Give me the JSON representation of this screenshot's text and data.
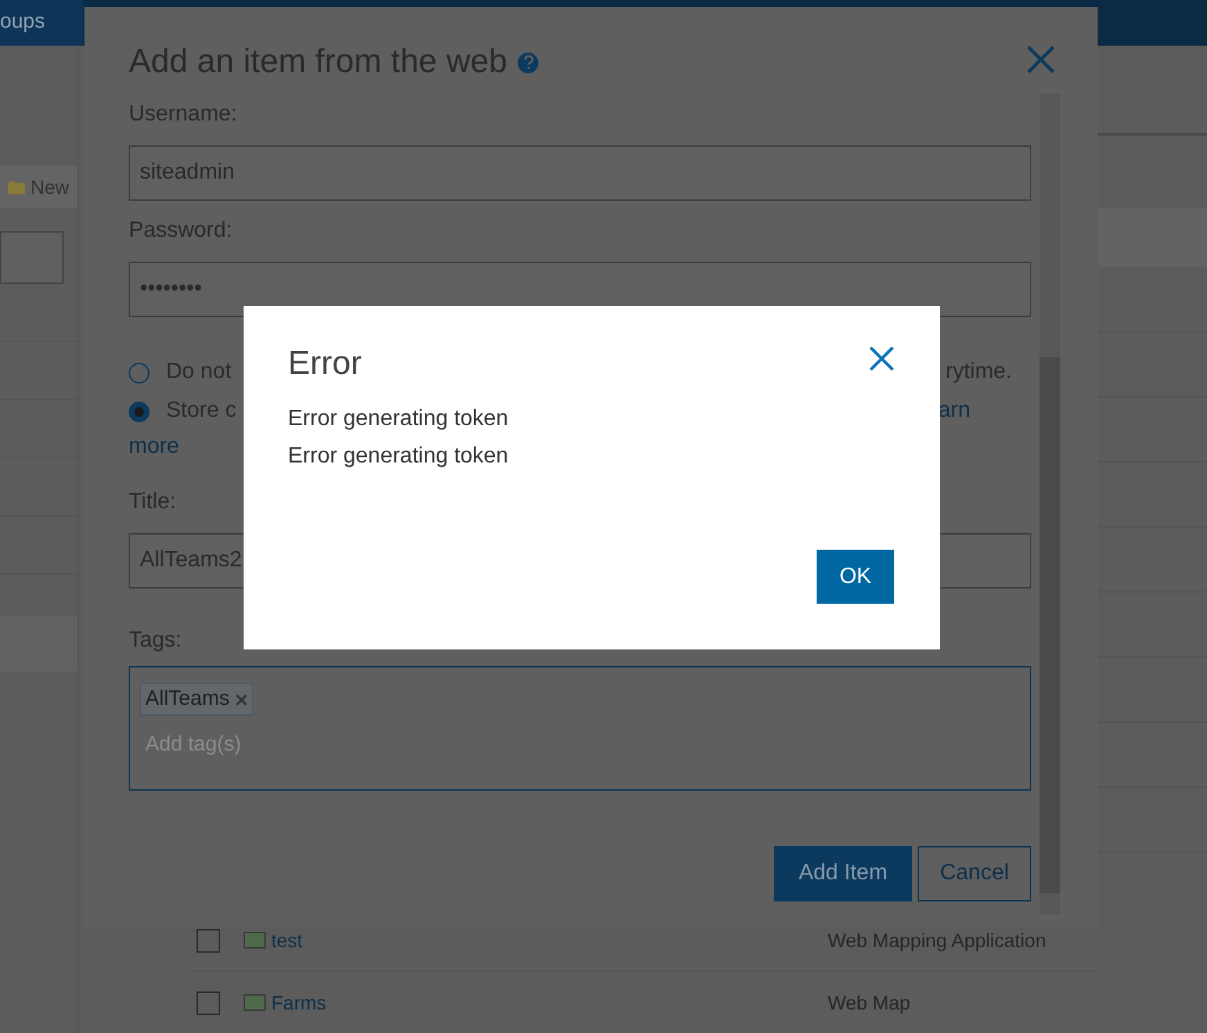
{
  "nav": {
    "tab": "oups"
  },
  "sidebar": {
    "new_button": "New"
  },
  "list": {
    "rows": [
      {
        "name": "test",
        "type": "Web Mapping Application",
        "checked": false
      },
      {
        "name": "Farms",
        "type": "Web Map",
        "checked": false
      }
    ]
  },
  "dialog": {
    "title": "Add an item from the web",
    "fields": [
      {
        "label": "Username:",
        "value": "siteadmin"
      },
      {
        "label": "Password:",
        "value": "••••••••"
      }
    ],
    "credentials": [
      {
        "text": "Do not",
        "tail": "rytime.",
        "selected": false
      },
      {
        "text": "Store c",
        "tail": "arn",
        "selected": true
      }
    ],
    "learn_more": "more",
    "title_field": {
      "label": "Title:",
      "value": "AllTeams2"
    },
    "tags": {
      "label": "Tags:",
      "chips": [
        "AllTeams"
      ],
      "placeholder": "Add tag(s)"
    },
    "buttons": [
      {
        "label": "Add Item",
        "kind": "primary"
      },
      {
        "label": "Cancel",
        "kind": "secondary"
      }
    ]
  },
  "error": {
    "title": "Error",
    "messages": [
      "Error generating token",
      "Error generating token"
    ],
    "button": "OK"
  }
}
